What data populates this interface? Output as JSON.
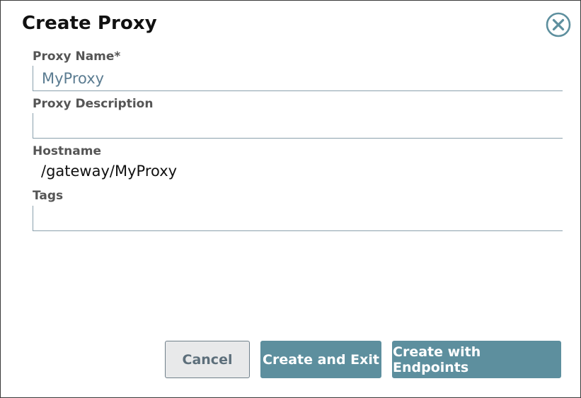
{
  "dialog": {
    "title": "Create Proxy",
    "close_icon": "close-circle-icon"
  },
  "form": {
    "proxy_name": {
      "label": "Proxy Name*",
      "value": "MyProxy"
    },
    "proxy_description": {
      "label": "Proxy Description",
      "value": ""
    },
    "hostname": {
      "label": "Hostname",
      "value": "/gateway/MyProxy"
    },
    "tags": {
      "label": "Tags",
      "value": ""
    }
  },
  "actions": {
    "cancel_label": "Cancel",
    "create_exit_label": "Create and Exit",
    "create_endpoints_label": "Create with Endpoints"
  },
  "colors": {
    "primary": "#5d8f9e",
    "close_icon": "#5d8f9e",
    "input_text": "#5b7c91"
  }
}
